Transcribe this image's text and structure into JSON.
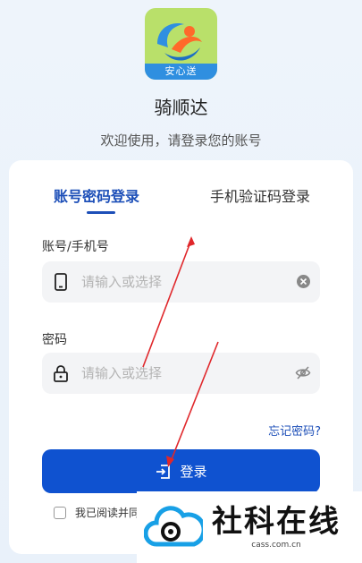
{
  "app": {
    "logo_band_text": "安心送",
    "name": "骑顺达",
    "welcome": "欢迎使用，请登录您的账号"
  },
  "tabs": [
    {
      "label": "账号密码登录",
      "active": true
    },
    {
      "label": "手机验证码登录",
      "active": false
    }
  ],
  "form": {
    "account_label": "账号/手机号",
    "account_placeholder": "请输入或选择",
    "password_label": "密码",
    "password_placeholder": "请输入或选择",
    "forgot_label": "忘记密码?",
    "login_label": "登录",
    "agreement_text": "我已阅读并同"
  },
  "watermark": {
    "title": "社科在线",
    "url": "cass.com.cn"
  },
  "icons": {
    "phone": "phone-icon",
    "lock": "lock-icon",
    "clear": "clear-icon",
    "eye_off": "eye-off-icon",
    "login": "login-icon"
  },
  "colors": {
    "primary": "#0f52d0",
    "tab_active": "#1d4fb8",
    "logo_bg": "#b9e06a",
    "annotation": "#e0272b"
  }
}
